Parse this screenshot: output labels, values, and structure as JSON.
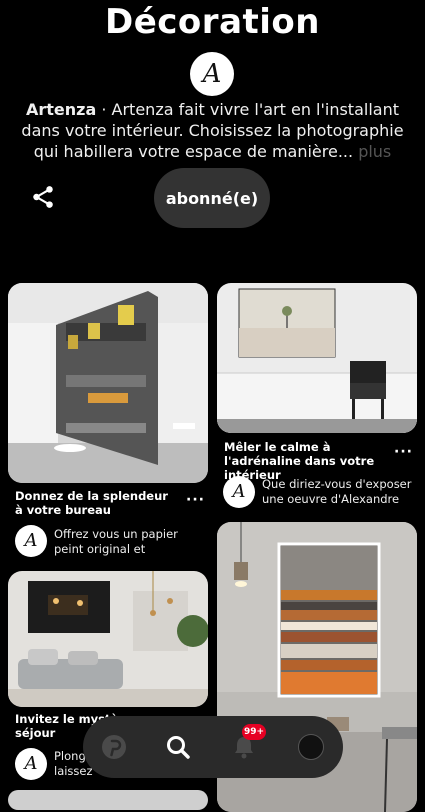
{
  "board": {
    "title": "Décoration",
    "owner": "Artenza",
    "separator": " · ",
    "description": "Artenza fait vivre l'art en l'installant dans votre intérieur. Choisissez la photographie qui habillera votre espace de manière...",
    "more_label": "plus",
    "follow_label": "abonné(e)"
  },
  "pins": [
    {
      "title": "Donnez de la splendeur à votre bureau",
      "text": "Offrez vous un papier peint original et artistique. Mis..."
    },
    {
      "title": "Mêler le calme à l'adrénaline dans votre intérieur",
      "text": "Que diriez-vous d'exposer une oeuvre d'Alexandre C..."
    },
    {
      "title": "Invitez le mystè",
      "title_end": "séjour",
      "text": "Plong",
      "text_end": "laissez v"
    },
    {
      "title": ""
    }
  ],
  "nav": {
    "badge": "99+",
    "items": [
      "pinterest-home-icon",
      "search-icon",
      "notifications-bell-icon",
      "profile-avatar"
    ]
  },
  "colors": {
    "accent": "#e60023",
    "background": "#000000"
  }
}
